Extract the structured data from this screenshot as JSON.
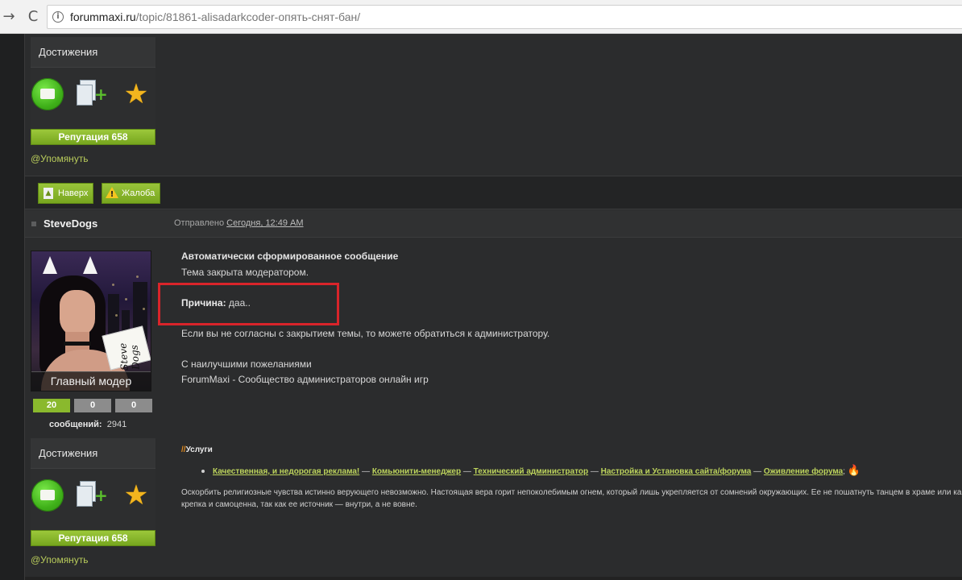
{
  "browser": {
    "url_host": "forummaxi.ru",
    "url_path": "/topic/81861-alisadarkcoder-опять-снят-бан/",
    "back_glyph": "→",
    "reload_glyph": "C",
    "info_glyph": "i"
  },
  "prev_post": {
    "achievements_title": "Достижения",
    "reputation": "Репутация 658",
    "mention": "@Упомянуть"
  },
  "actions": {
    "top_label": "Наверх",
    "report_label": "Жалоба"
  },
  "post": {
    "author": "SteveDogs",
    "posted_prefix": "Отправлено",
    "posted_date": "Сегодня, 12:49 AM",
    "rank": "Главный модер",
    "sign_text": "Steve Dogs",
    "counters": [
      "20",
      "0",
      "0"
    ],
    "messages_label": "сообщений:",
    "messages_count": "2941",
    "achievements_title": "Достижения",
    "reputation": "Репутация 658",
    "mention": "@Упомянуть",
    "body": {
      "title": "Автоматически сформированное сообщение",
      "line1": "Тема закрыта модератором.",
      "reason_label": "Причина:",
      "reason_value": " даа..",
      "line3": "Если вы не согласны с закрытием темы, то можете обратиться к администратору.",
      "regards": "С наилучшими пожеланиями",
      "signoff": "ForumMaxi - Сообщество администраторов онлайн игр"
    },
    "services": {
      "slashes": "//",
      "title": "Услуги",
      "links": [
        "Качественная, и недорогая реклама!",
        "Комьюнити-менеджер",
        "Технический администратор",
        "Настройка и Установка сайта/форума",
        "Оживление форума"
      ],
      "separator": " — ",
      "tail": ";"
    },
    "signature_line1": "Оскорбить религиозные чувства истинно верующего невозможно. Настоящая вера горит непоколебимым огнем, который лишь укрепляется от сомнений окружающих. Ее не пошатнуть танцем в храме или карти",
    "signature_line2": "крепка и самоценна, так как ее источник — внутри, а не вовне."
  },
  "colors": {
    "accent_green": "#8ab92d",
    "highlight_red": "#d9242a",
    "link_green": "#bdd45c"
  }
}
